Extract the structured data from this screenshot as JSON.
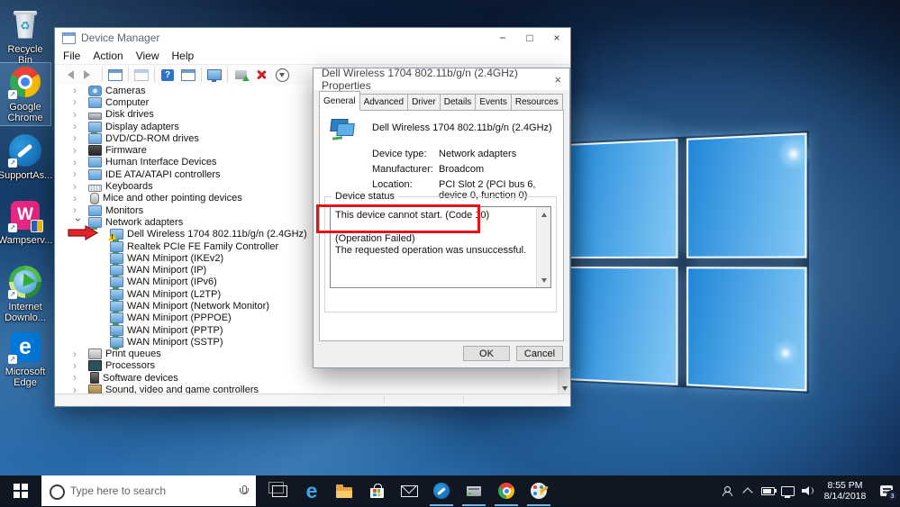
{
  "colors": {
    "accent": "#0078d7",
    "annotation_red": "#e0151b",
    "warning_yellow": "#f2c500",
    "taskbar_bg": "#101722",
    "open_underline": "#76b9ed"
  },
  "desktop": {
    "icons": [
      {
        "name": "recycle-bin",
        "label": "Recycle Bin",
        "selected": false
      },
      {
        "name": "google-chrome",
        "label": "Google Chrome",
        "selected": true
      },
      {
        "name": "supportassist",
        "label": "SupportAs...",
        "selected": false
      },
      {
        "name": "wampserver",
        "label": "Wampserv...",
        "selected": false
      },
      {
        "name": "internet-download-manager",
        "label": "Internet Downlo...",
        "selected": false
      },
      {
        "name": "microsoft-edge",
        "label": "Microsoft Edge",
        "selected": false
      }
    ]
  },
  "device_manager": {
    "title": "Device Manager",
    "menu": [
      "File",
      "Action",
      "View",
      "Help"
    ],
    "toolbar": [
      "back",
      "forward",
      "show-console-tree",
      "export",
      "help",
      "properties",
      "scan-hardware-changes",
      "update-driver",
      "uninstall-device",
      "disable-device"
    ],
    "tree": [
      {
        "label": "Cameras",
        "expander": "collapsed",
        "icon": "camera"
      },
      {
        "label": "Computer",
        "expander": "collapsed",
        "icon": "computer"
      },
      {
        "label": "Disk drives",
        "expander": "collapsed",
        "icon": "disk"
      },
      {
        "label": "Display adapters",
        "expander": "collapsed",
        "icon": "display"
      },
      {
        "label": "DVD/CD-ROM drives",
        "expander": "collapsed",
        "icon": "dvd"
      },
      {
        "label": "Firmware",
        "expander": "collapsed",
        "icon": "firmware"
      },
      {
        "label": "Human Interface Devices",
        "expander": "collapsed",
        "icon": "hid"
      },
      {
        "label": "IDE ATA/ATAPI controllers",
        "expander": "collapsed",
        "icon": "ide"
      },
      {
        "label": "Keyboards",
        "expander": "collapsed",
        "icon": "keyboard"
      },
      {
        "label": "Mice and other pointing devices",
        "expander": "collapsed",
        "icon": "mouse"
      },
      {
        "label": "Monitors",
        "expander": "collapsed",
        "icon": "monitor"
      },
      {
        "label": "Network adapters",
        "expander": "expanded",
        "icon": "network"
      },
      {
        "label": "Dell Wireless 1704 802.11b/g/n (2.4GHz)",
        "child": true,
        "icon": "network",
        "warning": true,
        "annotated": true
      },
      {
        "label": "Realtek PCIe FE Family Controller",
        "child": true,
        "icon": "network"
      },
      {
        "label": "WAN Miniport (IKEv2)",
        "child": true,
        "icon": "network"
      },
      {
        "label": "WAN Miniport (IP)",
        "child": true,
        "icon": "network"
      },
      {
        "label": "WAN Miniport (IPv6)",
        "child": true,
        "icon": "network"
      },
      {
        "label": "WAN Miniport (L2TP)",
        "child": true,
        "icon": "network"
      },
      {
        "label": "WAN Miniport (Network Monitor)",
        "child": true,
        "icon": "network"
      },
      {
        "label": "WAN Miniport (PPPOE)",
        "child": true,
        "icon": "network"
      },
      {
        "label": "WAN Miniport (PPTP)",
        "child": true,
        "icon": "network"
      },
      {
        "label": "WAN Miniport (SSTP)",
        "child": true,
        "icon": "network"
      },
      {
        "label": "Print queues",
        "expander": "collapsed",
        "icon": "printer"
      },
      {
        "label": "Processors",
        "expander": "collapsed",
        "icon": "processor"
      },
      {
        "label": "Software devices",
        "expander": "collapsed",
        "icon": "software"
      },
      {
        "label": "Sound, video and game controllers",
        "expander": "collapsed",
        "icon": "sound"
      }
    ]
  },
  "properties_dialog": {
    "title": "Dell Wireless 1704 802.11b/g/n (2.4GHz) Properties",
    "tabs": [
      "General",
      "Advanced",
      "Driver",
      "Details",
      "Events",
      "Resources"
    ],
    "active_tab": "General",
    "device_name": "Dell Wireless 1704 802.11b/g/n (2.4GHz)",
    "fields": [
      {
        "label": "Device type:",
        "value": "Network adapters"
      },
      {
        "label": "Manufacturer:",
        "value": "Broadcom"
      },
      {
        "label": "Location:",
        "value": "PCI Slot 2 (PCI bus 6, device 0, function 0)"
      }
    ],
    "group_label": "Device status",
    "status_lines": [
      "This device cannot start. (Code 10)",
      "",
      "(Operation Failed)",
      "The requested operation was unsuccessful."
    ],
    "buttons": {
      "ok": "OK",
      "cancel": "Cancel"
    }
  },
  "taskbar": {
    "search_placeholder": "Type here to search",
    "items": [
      {
        "name": "task-view",
        "open": false
      },
      {
        "name": "microsoft-edge",
        "open": false
      },
      {
        "name": "file-explorer",
        "open": false
      },
      {
        "name": "microsoft-store",
        "open": false
      },
      {
        "name": "mail",
        "open": false
      },
      {
        "name": "supportassist",
        "open": true
      },
      {
        "name": "device-manager",
        "open": true
      },
      {
        "name": "google-chrome",
        "open": true
      },
      {
        "name": "paint-app",
        "open": true
      }
    ],
    "tray": {
      "time": "8:55 PM",
      "date": "8/14/2018",
      "notification_count": "3"
    }
  }
}
